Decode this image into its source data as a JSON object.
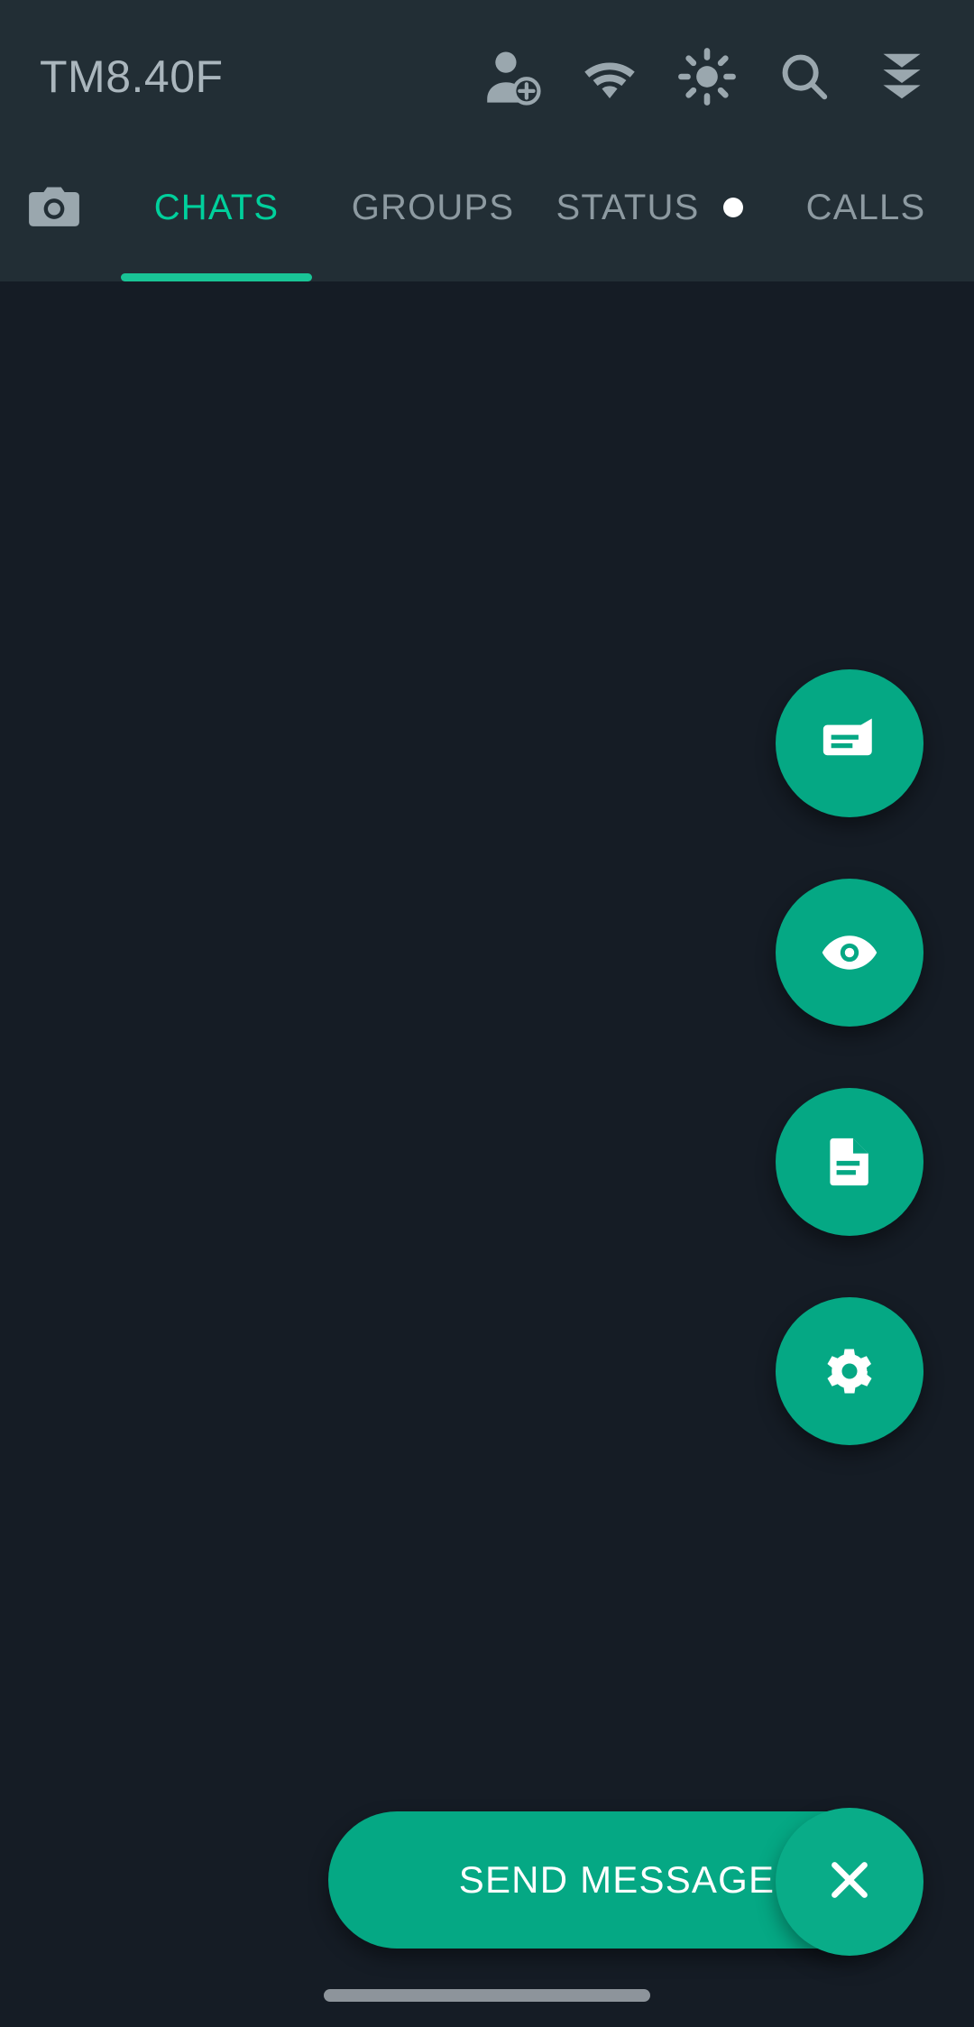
{
  "header": {
    "title": "TM8.40F",
    "actions": [
      {
        "name": "add-person-icon",
        "label": "Add contact"
      },
      {
        "name": "wifi-icon",
        "label": "Wi-Fi"
      },
      {
        "name": "brightness-icon",
        "label": "Brightness"
      },
      {
        "name": "search-icon",
        "label": "Search"
      },
      {
        "name": "double-chevron-down-icon",
        "label": "More"
      }
    ]
  },
  "tabbar": {
    "camera_icon": "camera-icon",
    "tabs": [
      {
        "label": "CHATS",
        "active": true,
        "dot": false
      },
      {
        "label": "GROUPS",
        "active": false,
        "dot": false
      },
      {
        "label": "STATUS",
        "active": false,
        "dot": true
      },
      {
        "label": "CALLS",
        "active": false,
        "dot": false
      }
    ]
  },
  "fab_menu": {
    "items": [
      {
        "icon": "message-icon",
        "label": "New message"
      },
      {
        "icon": "eye-icon",
        "label": "Views"
      },
      {
        "icon": "document-icon",
        "label": "Document"
      },
      {
        "icon": "gear-icon",
        "label": "Settings"
      }
    ],
    "send_label": "SEND MESSAGE",
    "close_icon": "close-icon"
  },
  "navbar": {
    "gesture_pill": "gesture-nav-pill"
  },
  "colors": {
    "accent": "#05a884",
    "accent_text": "#00d09c",
    "appbar_bg": "#222e35",
    "body_bg": "#151c25",
    "icon_muted": "#8d9aa1",
    "title": "#aab6bd"
  }
}
